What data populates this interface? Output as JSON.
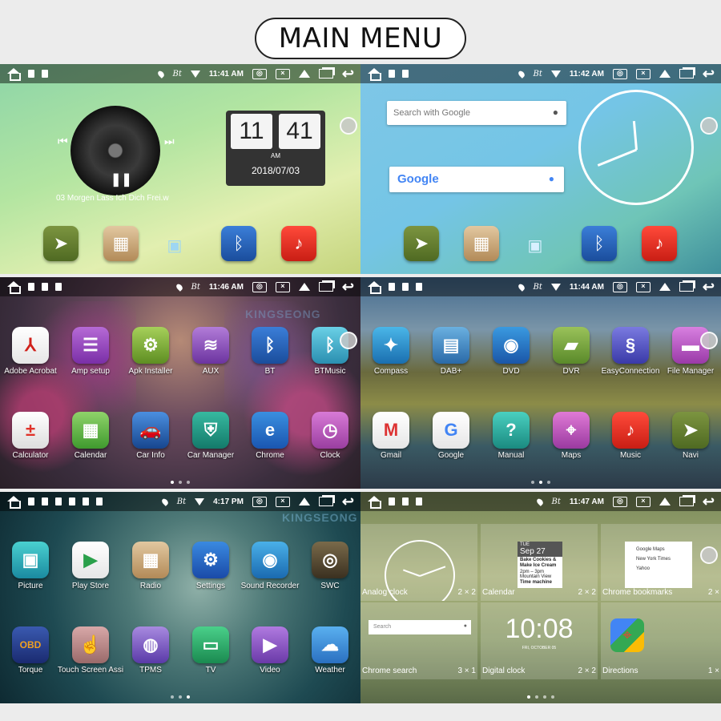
{
  "title": "MAIN MENU",
  "watermark": "KINGSEONG",
  "panels": {
    "p1": {
      "time": "11:41 AM",
      "song": "03 Morgen Lass Ich Dich Frei.w",
      "clock_hour": "11",
      "clock_min": "41",
      "clock_ampm": "AM",
      "date": "2018/07/03"
    },
    "p2": {
      "time": "11:42 AM",
      "search_placeholder": "Search with Google",
      "google": "Google"
    },
    "p3": {
      "time": "11:46 AM",
      "apps": [
        "Adobe Acrobat",
        "Amp setup",
        "Apk Installer",
        "AUX",
        "BT",
        "BTMusic",
        "Calculator",
        "Calendar",
        "Car Info",
        "Car Manager",
        "Chrome",
        "Clock"
      ]
    },
    "p4": {
      "time": "11:44 AM",
      "apps": [
        "Compass",
        "DAB+",
        "DVD",
        "DVR",
        "EasyConnection",
        "File Manager",
        "Gmail",
        "Google",
        "Manual",
        "Maps",
        "Music",
        "Navi"
      ]
    },
    "p5": {
      "time": "4:17 PM",
      "apps": [
        "Picture",
        "Play Store",
        "Radio",
        "Settings",
        "Sound Recorder",
        "SWC",
        "Torque",
        "Touch Screen Assi",
        "TPMS",
        "TV",
        "Video",
        "Weather"
      ]
    },
    "p6": {
      "time": "11:47 AM",
      "widgets": [
        {
          "name": "Analog clock",
          "size": "2 × 2"
        },
        {
          "name": "Calendar",
          "size": "2 × 2"
        },
        {
          "name": "Chrome bookmarks",
          "size": "2 ×"
        },
        {
          "name": "Chrome search",
          "size": "3 × 1"
        },
        {
          "name": "Digital clock",
          "size": "2 × 2"
        },
        {
          "name": "Directions",
          "size": "1 ×"
        }
      ],
      "cal_day": "TUE",
      "cal_date": "Sep 27",
      "cal_ev1": "Bake Cookies & Make Ice Cream",
      "cal_ev2": "2pm – 3pm",
      "cal_ev3": "Mountain View",
      "cal_ev4": "Time machine",
      "bm1": "Google Maps",
      "bm2": "New York Times",
      "bm3": "Yahoo",
      "search": "Search",
      "digital": "10:08",
      "digital_date": "FRI, OCTOBER 05"
    }
  }
}
